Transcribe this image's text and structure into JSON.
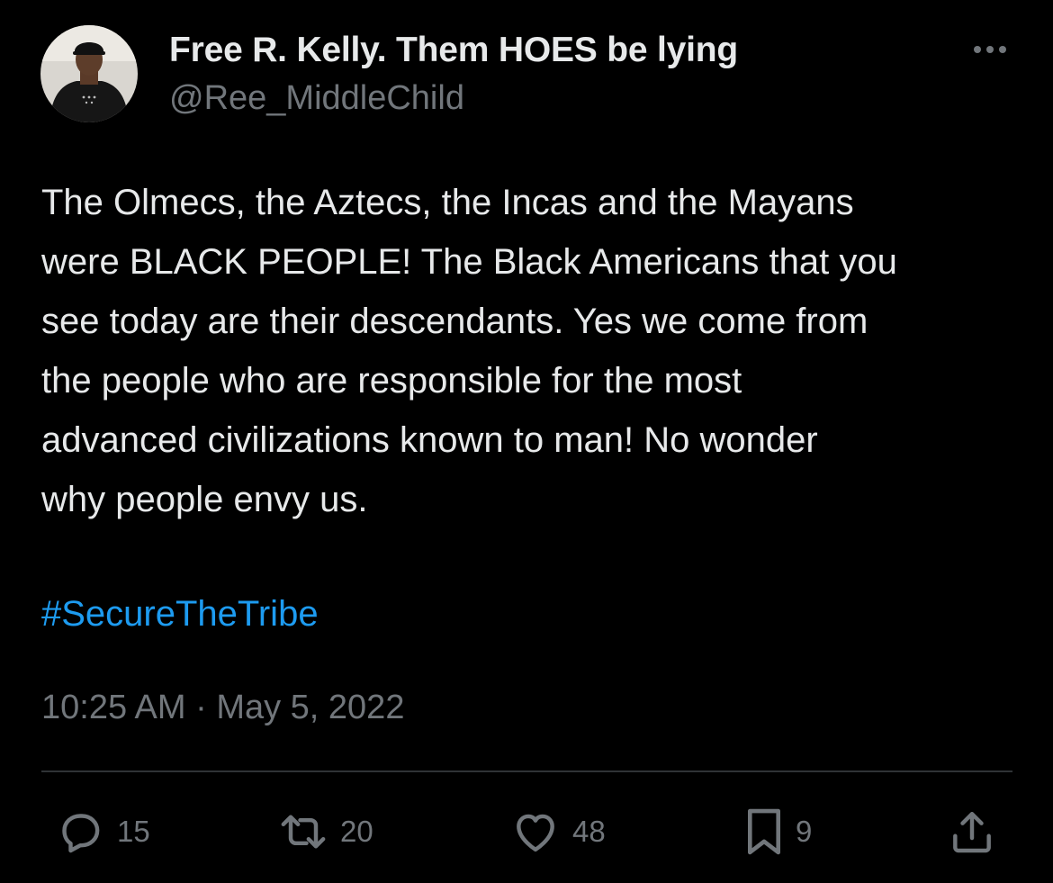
{
  "author": {
    "display_name": "Free R. Kelly. Them HOES be lying",
    "handle": "@Ree_MiddleChild",
    "avatar_icon": "user-avatar-photo"
  },
  "tweet": {
    "text_lines": [
      "The Olmecs, the Aztecs, the Incas and the Mayans",
      "were BLACK PEOPLE! The Black Americans that you",
      "see today are their descendants. Yes we come from",
      "the people who are responsible for the most",
      "advanced civilizations known to man! No wonder",
      "why people envy us."
    ],
    "hashtag": "#SecureTheTribe",
    "timestamp": "10:25 AM · May 5, 2022"
  },
  "actions": {
    "reply": {
      "icon": "reply-icon",
      "count": "15"
    },
    "retweet": {
      "icon": "retweet-icon",
      "count": "20"
    },
    "like": {
      "icon": "heart-icon",
      "count": "48"
    },
    "bookmark": {
      "icon": "bookmark-icon",
      "count": "9"
    },
    "share": {
      "icon": "share-icon"
    }
  },
  "colors": {
    "background": "#000000",
    "text": "#e7e9ea",
    "muted": "#71767b",
    "link": "#1d9bf0",
    "divider": "#2f3336"
  }
}
